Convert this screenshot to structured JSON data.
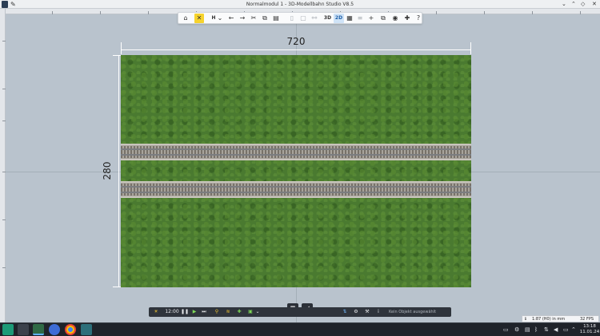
{
  "window": {
    "title": "Normalmodul 1 - 3D-Modellbahn Studio V8.5",
    "controls": [
      "⌄",
      "⌃",
      "◇",
      "✕"
    ]
  },
  "toolbar": {
    "home": "⌂",
    "tools": "✕",
    "save": "H",
    "dropdown": "⌄",
    "undo": "←",
    "redo": "→",
    "cut": "✂",
    "copy": "⧉",
    "paste": "▤",
    "view_3d": "3D",
    "view_2d": "2D",
    "grid": "▦",
    "add": "+",
    "catalog": "⧉",
    "camera": "◉",
    "plugins": "✚",
    "help": "?"
  },
  "dimensions": {
    "width_label": "720",
    "height_label": "280"
  },
  "bottom_toolbar": {
    "time": "12:00",
    "status": "Kein Objekt ausgewählt"
  },
  "info": {
    "scale": "1:87 (H0) in mm",
    "fps": "32 FPS"
  },
  "taskbar": {
    "time": "13:18",
    "date": "11.01.24"
  },
  "colors": {
    "active_tool": "#f6d32d",
    "grass": "#4a7a30",
    "track_ballast": "#a8a49c",
    "taskbar": "#1f232a"
  }
}
